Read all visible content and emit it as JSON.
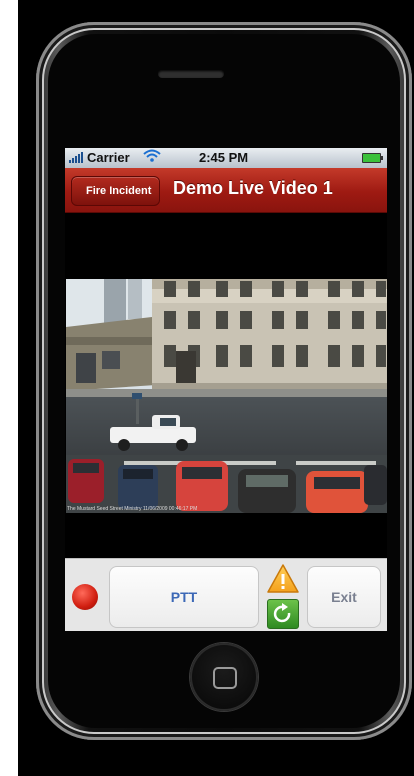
{
  "status_bar": {
    "carrier": "Carrier",
    "time": "2:45 PM"
  },
  "nav_bar": {
    "back_label": "Fire Incident",
    "title": "Demo Live Video 1"
  },
  "video": {
    "caption": "The Mustard Seed Street Ministry 11/06/2009 00:46:17 PM"
  },
  "controls": {
    "ptt_label": "PTT",
    "exit_label": "Exit"
  },
  "colors": {
    "nav_red": "#9e1a12",
    "ptt_text": "#3c68b6",
    "record_red": "#d01e10",
    "warning": "#f4a11c",
    "refresh_green": "#2f8a22"
  },
  "icons": [
    "signal-icon",
    "wifi-icon",
    "battery-icon",
    "back-chevron-icon",
    "record-icon",
    "warning-icon",
    "refresh-icon",
    "home-button"
  ]
}
